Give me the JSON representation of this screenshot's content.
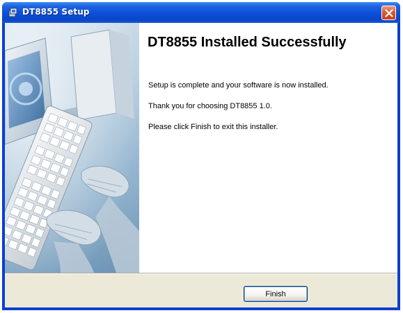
{
  "window": {
    "title": "DT8855 Setup"
  },
  "content": {
    "heading": "DT8855 Installed Successfully",
    "line1": "Setup is complete and your software is now installed.",
    "line2": "Thank you for choosing DT8855 1.0.",
    "line3": "Please click Finish to exit this installer."
  },
  "buttons": {
    "finish_label": "Finish"
  },
  "colors": {
    "titlebar": "#0a4fd9",
    "close_button": "#dc5a33",
    "panel_bg": "#ece9d8"
  }
}
